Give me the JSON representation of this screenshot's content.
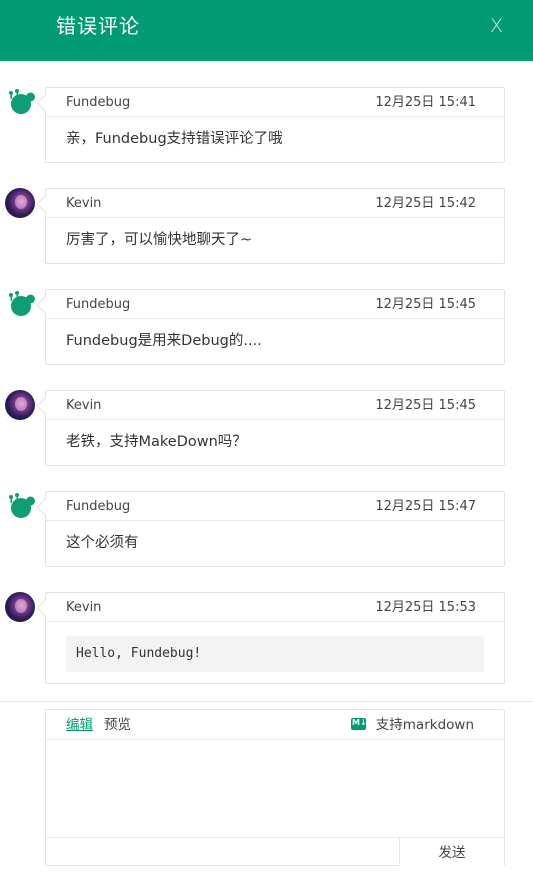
{
  "header": {
    "title": "错误评论",
    "close_label": "X"
  },
  "comments": [
    {
      "author": "Fundebug",
      "avatar": "fundebug-logo",
      "time": "12月25日 15:41",
      "text": "亲，Fundebug支持错误评论了哦"
    },
    {
      "author": "Kevin",
      "avatar": "kevin-photo",
      "time": "12月25日 15:42",
      "text": "厉害了，可以愉快地聊天了~"
    },
    {
      "author": "Fundebug",
      "avatar": "fundebug-logo",
      "time": "12月25日 15:45",
      "text": "Fundebug是用来Debug的...."
    },
    {
      "author": "Kevin",
      "avatar": "kevin-photo",
      "time": "12月25日 15:45",
      "text": "老铁，支持MakeDown吗？"
    },
    {
      "author": "Fundebug",
      "avatar": "fundebug-logo",
      "time": "12月25日 15:47",
      "text": "这个必须有"
    },
    {
      "author": "Kevin",
      "avatar": "kevin-photo",
      "time": "12月25日 15:53",
      "code": "Hello, Fundebug!"
    }
  ],
  "editor": {
    "tab_edit": "编辑",
    "tab_preview": "预览",
    "markdown_icon": "M↓",
    "markdown_support": "支持markdown",
    "input_value": "",
    "send_label": "发送"
  },
  "colors": {
    "brand": "#009b72",
    "border": "#e3e3e3"
  }
}
